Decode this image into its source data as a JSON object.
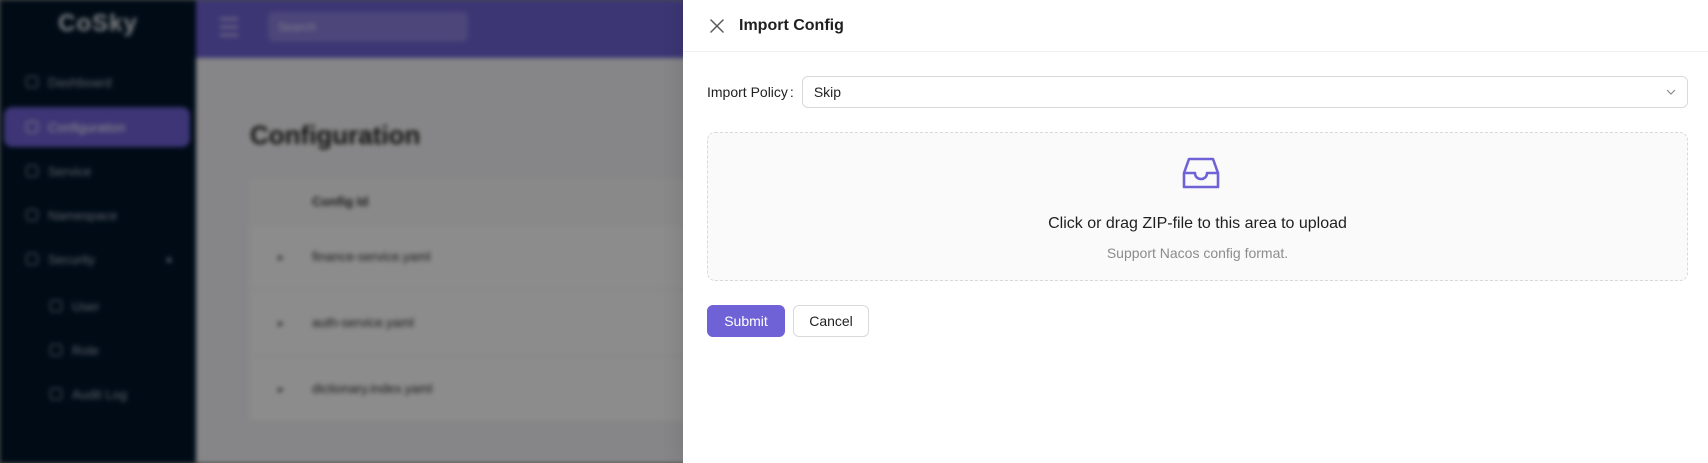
{
  "app": {
    "logo": "CoSky",
    "sidebar": {
      "items": [
        {
          "label": "Dashboard",
          "icon": "dashboard-icon"
        },
        {
          "label": "Configuration",
          "icon": "config-icon",
          "active": true
        },
        {
          "label": "Service",
          "icon": "service-icon"
        },
        {
          "label": "Namespace",
          "icon": "namespace-icon"
        },
        {
          "label": "Security",
          "icon": "security-icon"
        },
        {
          "label": "User",
          "icon": "user-icon"
        },
        {
          "label": "Role",
          "icon": "role-icon"
        },
        {
          "label": "Audit Log",
          "icon": "audit-log-icon"
        }
      ]
    },
    "header": {
      "search_placeholder": "Search"
    },
    "page_title": "Configuration",
    "table": {
      "columns": [
        "Config Id"
      ],
      "rows": [
        "finance-service.yaml",
        "auth-service.yaml",
        "dictionary.index.yaml"
      ]
    }
  },
  "drawer": {
    "title": "Import Config",
    "close_icon": "close-icon",
    "import_policy": {
      "label": "Import Policy",
      "colon": ":",
      "value": "Skip"
    },
    "upload": {
      "icon": "inbox-icon",
      "text": "Click or drag ZIP-file to this area to upload",
      "hint": "Support Nacos config format."
    },
    "submit_label": "Submit",
    "cancel_label": "Cancel"
  },
  "colors": {
    "accent": "#6f62d6",
    "sidebar_bg": "#001529",
    "mask": "rgba(0,0,0,0.45)"
  }
}
